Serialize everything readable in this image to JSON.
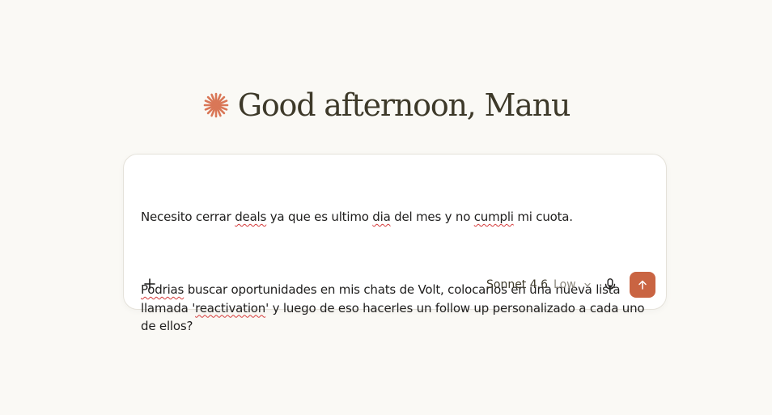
{
  "greeting": {
    "text": "Good afternoon, Manu",
    "icon": "claude-spark-icon",
    "icon_color": "#d97757"
  },
  "composer": {
    "message_lines": [
      [
        "Necesito cerrar ",
        "deals",
        " ya que es ultimo ",
        "dia",
        " del mes y no ",
        "cumpli",
        " mi cuota."
      ],
      [
        "Podrias",
        " buscar oportunidades en mis chats de Volt, colocarlos en una nueva lista llamada '",
        "reactivation",
        "' y luego de eso hacerles un follow up personalizado a cada uno de ellos?"
      ]
    ],
    "add_icon": "plus-icon",
    "model_name": "Sonnet 4.6",
    "effort_level": "Low",
    "mic_icon": "microphone-icon",
    "send_icon": "arrow-up-icon",
    "send_color": "#c96442"
  }
}
